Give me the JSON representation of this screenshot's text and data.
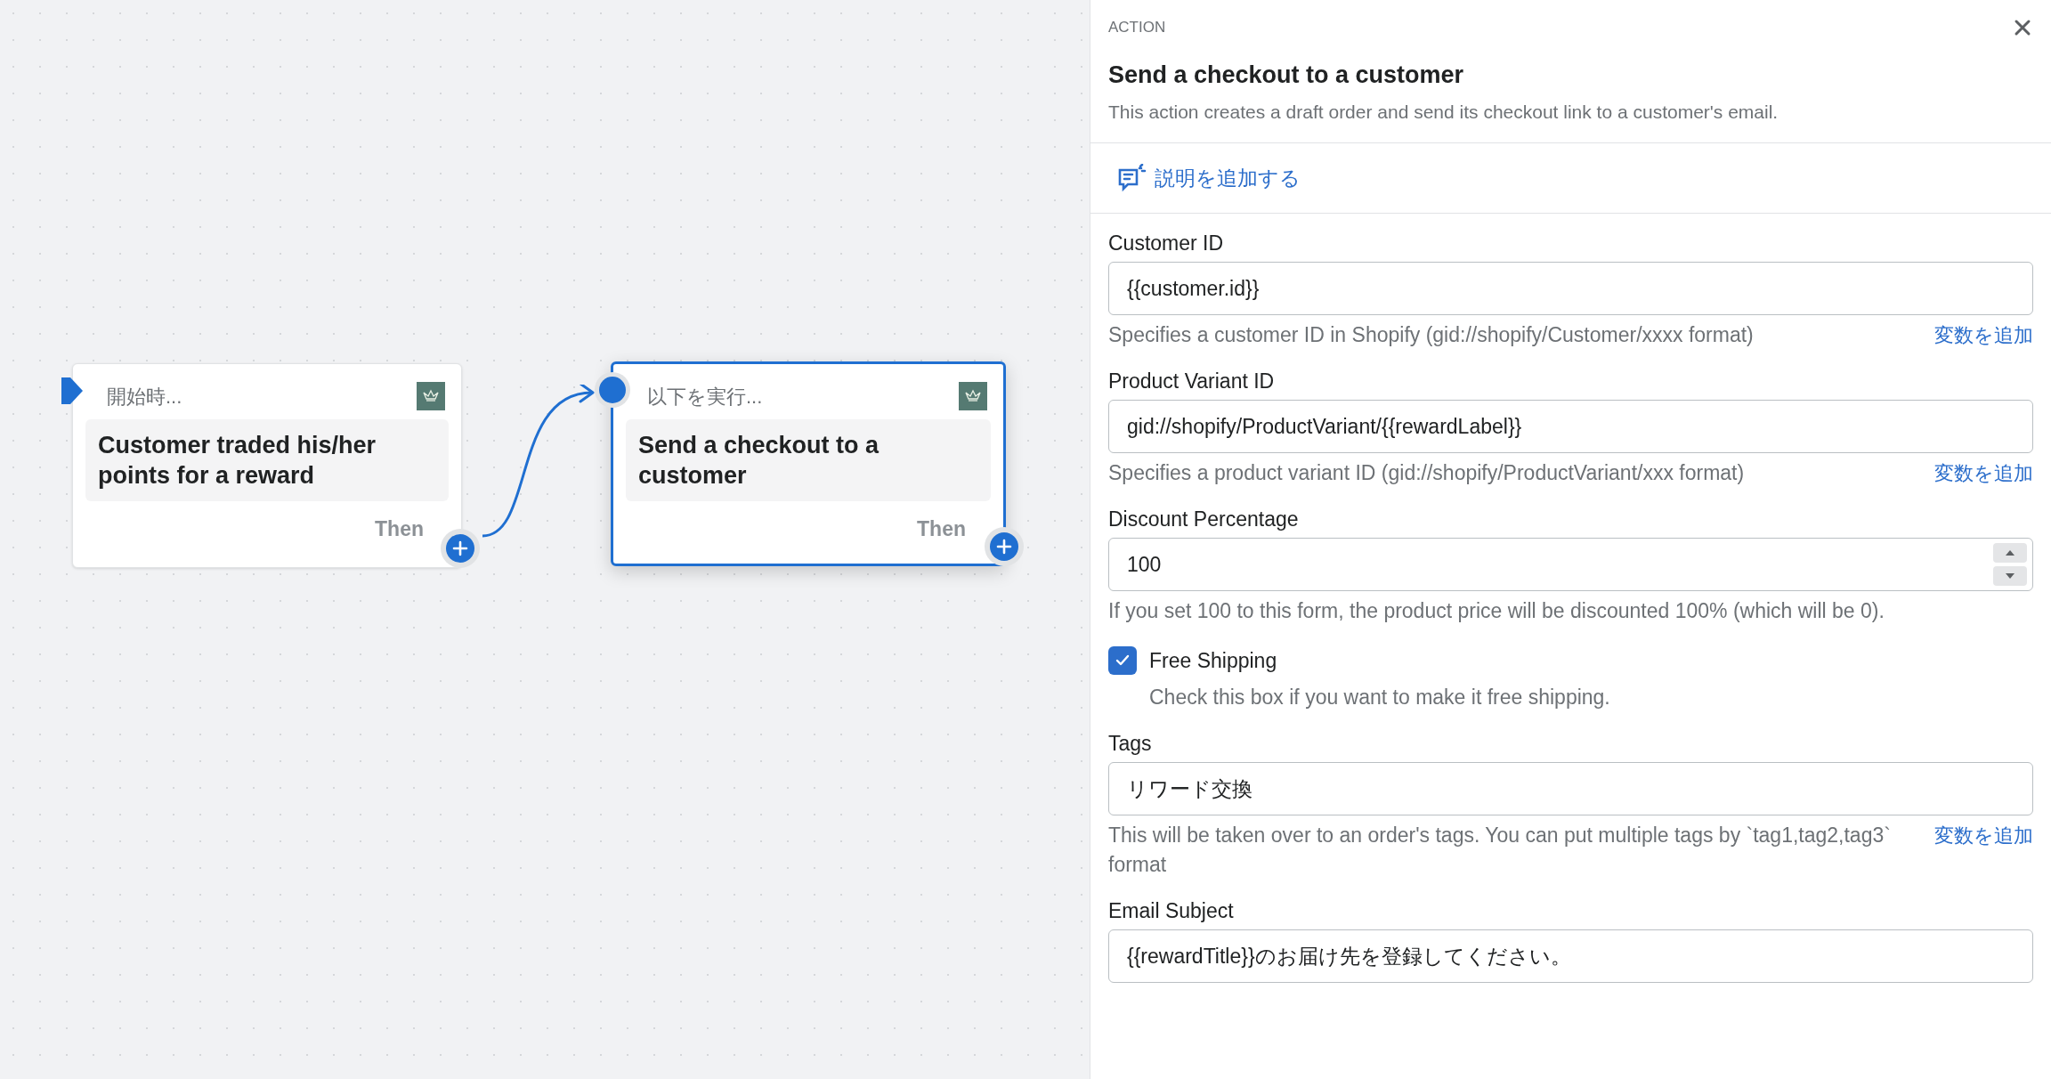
{
  "canvas": {
    "nodes": [
      {
        "kind": "trigger",
        "header": "開始時...",
        "title": "Customer traded his/her points for a reward",
        "footer": "Then",
        "selected": false
      },
      {
        "kind": "action",
        "header": "以下を実行...",
        "title": "Send a checkout to a customer",
        "footer": "Then",
        "selected": true
      }
    ]
  },
  "panel": {
    "eyebrow": "ACTION",
    "title": "Send a checkout to a customer",
    "description": "This action creates a draft order and send its checkout link to a customer's email.",
    "add_description": "説明を追加する",
    "fields": [
      {
        "kind": "text",
        "label": "Customer ID",
        "value": "{{customer.id}}",
        "help": "Specifies a customer ID in Shopify (gid://shopify/Customer/xxxx format)",
        "link": "変数を追加"
      },
      {
        "kind": "text",
        "label": "Product Variant ID",
        "value": "gid://shopify/ProductVariant/{{rewardLabel}}",
        "help": "Specifies a product variant ID (gid://shopify/ProductVariant/xxx format)",
        "link": "変数を追加"
      },
      {
        "kind": "number",
        "label": "Discount Percentage",
        "value": "100",
        "help": "If you set 100 to this form, the product price will be discounted 100% (which will be 0)."
      },
      {
        "kind": "checkbox",
        "label": "Free Shipping",
        "checked": true,
        "help": "Check this box if you want to make it free shipping."
      },
      {
        "kind": "text",
        "label": "Tags",
        "value": "リワード交換",
        "help": "This will be taken over to an order's tags. You can put multiple tags by `tag1,tag2,tag3` format",
        "link": "変数を追加"
      },
      {
        "kind": "text",
        "label": "Email Subject",
        "value": "{{rewardTitle}}のお届け先を登録してください。"
      }
    ]
  }
}
